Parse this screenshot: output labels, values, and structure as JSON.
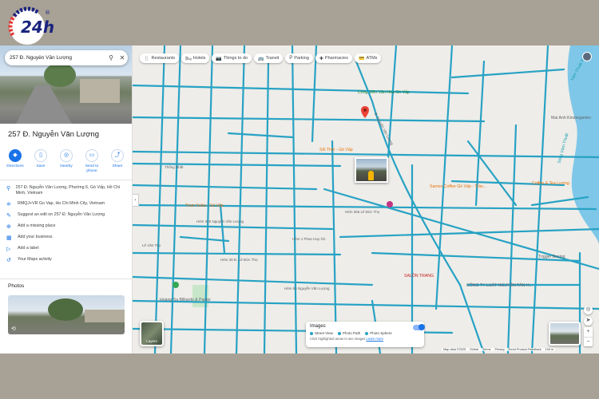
{
  "brand": {
    "logo_text": "24h",
    "logo_mark": "®"
  },
  "search": {
    "query": "257 Đ. Nguyễn Văn Lượng"
  },
  "place": {
    "title": "257 Đ. Nguyễn Văn Lượng",
    "actions": [
      {
        "label": "Directions",
        "icon": "directions-icon"
      },
      {
        "label": "Save",
        "icon": "bookmark-icon"
      },
      {
        "label": "Nearby",
        "icon": "nearby-icon"
      },
      {
        "label": "Send to phone",
        "icon": "phone-icon"
      },
      {
        "label": "Share",
        "icon": "share-icon"
      }
    ],
    "info": [
      {
        "icon": "location-pin-icon",
        "text": "257 Đ. Nguyễn Văn Lượng, Phường 6, Gò Vấp, Hồ Chí Minh, Vietnam"
      },
      {
        "icon": "plus-code-icon",
        "text": "RMQJ+VR Go Vap, Ho Chi Minh City, Vietnam"
      },
      {
        "icon": "edit-icon",
        "text": "Suggest an edit on 257 Đ. Nguyễn Văn Lượng"
      },
      {
        "icon": "add-place-icon",
        "text": "Add a missing place"
      },
      {
        "icon": "business-icon",
        "text": "Add your business"
      },
      {
        "icon": "label-icon",
        "text": "Add a label"
      },
      {
        "icon": "history-icon",
        "text": "Your Maps activity"
      }
    ],
    "photos_heading": "Photos"
  },
  "chips": [
    {
      "label": "Restaurants",
      "icon": "restaurant-icon"
    },
    {
      "label": "Hotels",
      "icon": "hotel-icon"
    },
    {
      "label": "Things to do",
      "icon": "camera-icon"
    },
    {
      "label": "Transit",
      "icon": "transit-icon"
    },
    {
      "label": "Parking",
      "icon": "parking-icon"
    },
    {
      "label": "Pharmacies",
      "icon": "pharmacy-icon"
    },
    {
      "label": "ATMs",
      "icon": "atm-icon"
    }
  ],
  "map_labels": {
    "park": "Công Viên Văn Hóa Gò Vấp",
    "cafe": "Sổi Thời - Gò Vấp",
    "tram_xuan": "Tram Xuân - Gò Vấp",
    "school": "Mai Anh Kindergarten",
    "coffee": "Samos Coffee Gò Vấp - Trần...",
    "river": "Vàm Thuật River",
    "river2": "Sông Vàm Thuật",
    "hospital": "Hoàng Sa Billiards & Pastor",
    "company": "CÔNG TY LUẬT NGUYỄN TÂN H...",
    "shop": "Trigger Boxing",
    "road1": "Đ. Nguyễn Văn Lượng",
    "road2": "Hẻm 365 Lê Đức Thọ",
    "road3": "Hẻm 325 Nguyễn Văn Lượng",
    "road4": "Hẻm 1 Phan Huy Ích",
    "road5": "Hẻm 36 Đ. Lê Đức Thọ",
    "road6": "Hẻm 54 Nguyễn Văn Lượng",
    "road7": "Lê Văn Thọ",
    "road8": "Thống Nhất",
    "coffee2": "Coffee & Tea Lương",
    "gym": "SALÔN TRANG"
  },
  "images_panel": {
    "title": "Images",
    "legend": [
      "Street View",
      "Photo Path",
      "Photo Sphere"
    ],
    "hint": "Click highlighted areas to see images",
    "hint_link": "Learn more"
  },
  "layers_label": "Layers",
  "footer": [
    "Map data ©2025",
    "Global",
    "Terms",
    "Privacy",
    "Send Product Feedback",
    "100 m"
  ],
  "colors": {
    "streetview": "#27a2c4",
    "pin": "#ea4335",
    "accent": "#1a73e8",
    "border": "#a7a196"
  }
}
